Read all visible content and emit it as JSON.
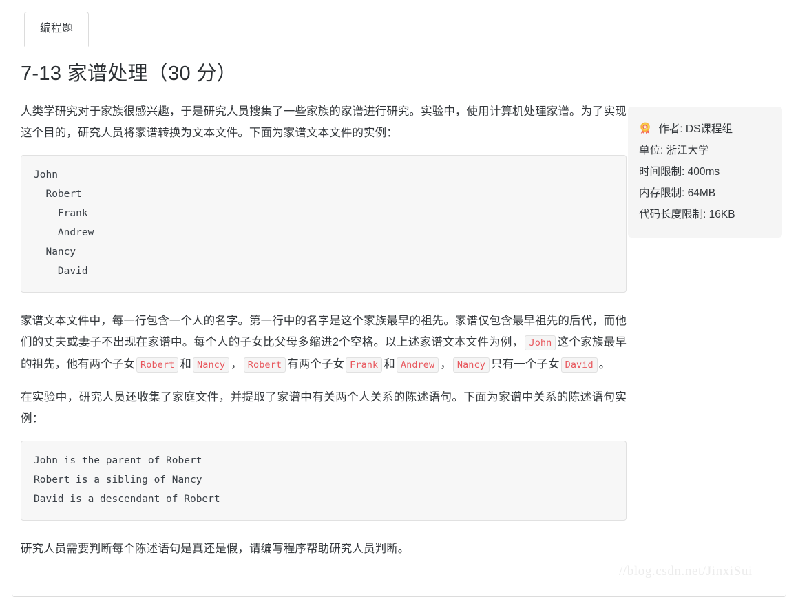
{
  "tabs": [
    {
      "label": "编程题",
      "active": true
    }
  ],
  "problem": {
    "title": "7-13 家谱处理（30 分）",
    "paragraph_1": "人类学研究对于家族很感兴趣，于是研究人员搜集了一些家族的家谱进行研究。实验中，使用计算机处理家谱。为了实现这个目的，研究人员将家谱转换为文本文件。下面为家谱文本文件的实例：",
    "code_block_1": "John\n  Robert\n    Frank\n    Andrew\n  Nancy\n    David",
    "paragraph_2_part_1": "家谱文本文件中，每一行包含一个人的名字。第一行中的名字是这个家族最早的祖先。家谱仅包含最早祖先的后代，而他们的丈夫或妻子不出现在家谱中。每个人的子女比父母多缩进2个空格。以上述家谱文本文件为例，",
    "paragraph_2_part_2": "这个家族最早的祖先，他有两个子女",
    "paragraph_2_part_3": "和",
    "paragraph_2_part_4": "，",
    "paragraph_2_part_5": "有两个子女",
    "paragraph_2_part_6": "和",
    "paragraph_2_part_7": "，",
    "paragraph_2_part_8": "只有一个子女",
    "paragraph_2_part_9": "。",
    "inline_john": "John",
    "inline_robert": "Robert",
    "inline_nancy": "Nancy",
    "inline_robert_2": "Robert",
    "inline_frank": "Frank",
    "inline_andrew": "Andrew",
    "inline_nancy_2": "Nancy",
    "inline_david": "David",
    "paragraph_3": "在实验中，研究人员还收集了家庭文件，并提取了家谱中有关两个人关系的陈述语句。下面为家谱中关系的陈述语句实例：",
    "code_block_2": "John is the parent of Robert\nRobert is a sibling of Nancy\nDavid is a descendant of Robert",
    "paragraph_4": "研究人员需要判断每个陈述语句是真还是假，请编写程序帮助研究人员判断。"
  },
  "info": {
    "icon": "medal-rosette-icon",
    "author": "作者: DS课程组",
    "organization": "单位: 浙江大学",
    "time_limit": "时间限制: 400ms",
    "memory_limit": "内存限制: 64MB",
    "code_length_limit": "代码长度限制: 16KB"
  },
  "watermark": "//blog.csdn.net/JinxiSui",
  "colors": {
    "inline_code_text": "#e8575d",
    "code_block_bg": "#f7f7f7",
    "info_box_bg": "#f5f5f5",
    "border": "#dcdcdc",
    "text": "#34383c",
    "watermark": "#ececec"
  }
}
